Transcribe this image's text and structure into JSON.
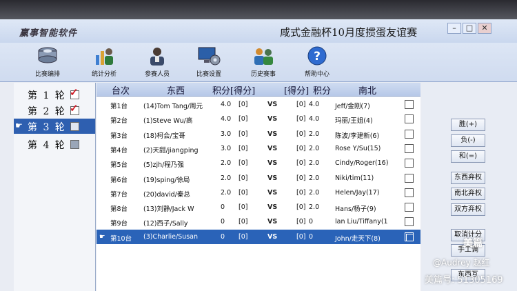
{
  "window": {
    "logo_text": "赢事智能软件",
    "title": "咸式金融杯10月度掼蛋友谊赛",
    "min_label": "–",
    "max_label": "□",
    "close_label": "✕"
  },
  "toolbar": {
    "items": [
      {
        "label": "比赛编排",
        "icon": "database-icon"
      },
      {
        "label": "统计分析",
        "icon": "people-chart-icon"
      },
      {
        "label": "参赛人员",
        "icon": "person-icon"
      },
      {
        "label": "比赛设置",
        "icon": "monitor-gear-icon"
      },
      {
        "label": "历史赛事",
        "icon": "history-people-icon"
      },
      {
        "label": "帮助中心",
        "icon": "help-icon"
      }
    ]
  },
  "rounds": [
    {
      "label": "第 1 轮",
      "checked": true
    },
    {
      "label": "第 2 轮",
      "checked": true
    },
    {
      "label": "第 3 轮",
      "checked": false,
      "selected": true
    },
    {
      "label": "第 4 轮",
      "checked": false
    }
  ],
  "grid": {
    "headers": {
      "table": "台次",
      "east_west": "东西",
      "points_ew": "积分",
      "score_ew": "[得分]",
      "score_ns": "[得分]",
      "points_ns": "积分",
      "north_south": "南北"
    },
    "vs_label": "VS",
    "rows": [
      {
        "table": "第1台",
        "ew": "(14)Tom Tang/周元",
        "ew_pts": "4.0",
        "ew_score": "[0]",
        "ns_score": "[0]",
        "ns_pts": "4.0",
        "ns": "Jeff/金刚(7)"
      },
      {
        "table": "第2台",
        "ew": "(1)Steve Wu/高",
        "ew_pts": "4.0",
        "ew_score": "[0]",
        "ns_score": "[0]",
        "ns_pts": "4.0",
        "ns": "玛丽/王姐(4)"
      },
      {
        "table": "第3台",
        "ew": "(18)柯会/宝哥",
        "ew_pts": "3.0",
        "ew_score": "[0]",
        "ns_score": "[0]",
        "ns_pts": "2.0",
        "ns": "陈波/李建新(6)"
      },
      {
        "table": "第4台",
        "ew": "(2)天甜/jiangping",
        "ew_pts": "3.0",
        "ew_score": "[0]",
        "ns_score": "[0]",
        "ns_pts": "2.0",
        "ns": "Rose Y/Su(15)"
      },
      {
        "table": "第5台",
        "ew": "(5)zjh/程乃强",
        "ew_pts": "2.0",
        "ew_score": "[0]",
        "ns_score": "[0]",
        "ns_pts": "2.0",
        "ns": "Cindy/Roger(16)"
      },
      {
        "table": "第6台",
        "ew": "(19)sping/徐局",
        "ew_pts": "2.0",
        "ew_score": "[0]",
        "ns_score": "[0]",
        "ns_pts": "2.0",
        "ns": "Niki/tim(11)"
      },
      {
        "table": "第7台",
        "ew": "(20)david/秦总",
        "ew_pts": "2.0",
        "ew_score": "[0]",
        "ns_score": "[0]",
        "ns_pts": "2.0",
        "ns": "Helen/Jay(17)"
      },
      {
        "table": "第8台",
        "ew": "(13)刘静/Jack W",
        "ew_pts": "0",
        "ew_score": "[0]",
        "ns_score": "[0]",
        "ns_pts": "2.0",
        "ns": "Hans/杨子(9)"
      },
      {
        "table": "第9台",
        "ew": "(12)西子/Sally",
        "ew_pts": "0",
        "ew_score": "[0]",
        "ns_score": "[0]",
        "ns_pts": "0",
        "ns": "lan Liu/Tiffany(1"
      },
      {
        "table": "第10台",
        "ew": "(3)Charlie/Susan",
        "ew_pts": "0",
        "ew_score": "[0]",
        "ns_score": "[0]",
        "ns_pts": "0",
        "ns": "John/走天下(8)",
        "selected": true
      }
    ]
  },
  "side_buttons": {
    "win": "胜(+)",
    "lose": "负(-)",
    "draw": "和(=)",
    "ew_forfeit": "东西弃权",
    "ns_forfeit": "南北弃权",
    "both_forfeit": "双方弃权",
    "cancel_score": "取消计分",
    "manual": "手工调",
    "more": "东西互"
  },
  "watermark": {
    "app": "美篇",
    "user": "@Audrey 赵红",
    "id": "美篇号: 51305169"
  },
  "colors": {
    "selection": "#2a63b8",
    "check_red": "#d0202a"
  }
}
